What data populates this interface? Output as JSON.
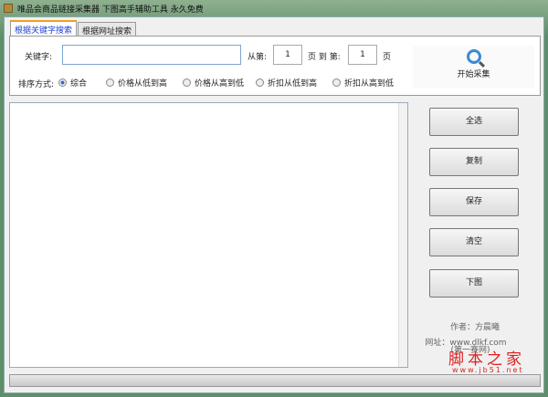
{
  "title": "唯品会商品链接采集器 下图高手辅助工具 永久免费",
  "tabs": [
    "根据关键字搜索",
    "根据网址搜索"
  ],
  "keyword_label": "关键字:",
  "keyword_value": "",
  "from_label": "从第:",
  "from_page": "1",
  "page_to_label": "页 到 第:",
  "to_page": "1",
  "page_label": "页",
  "sort_label": "排序方式:",
  "sort_options": [
    "综合",
    "价格从低到高",
    "价格从高到低",
    "折扣从低到高",
    "折扣从高到低"
  ],
  "start_button": "开始采集",
  "buttons": [
    "全选",
    "复制",
    "保存",
    "清空",
    "下图"
  ],
  "author": "作者：方晨曦",
  "website": "网址：www.dlkf.com",
  "website_note": "(第一赛网)",
  "watermark": {
    "name": "脚本之家",
    "url": "www.jb51.net"
  },
  "progress": 0
}
